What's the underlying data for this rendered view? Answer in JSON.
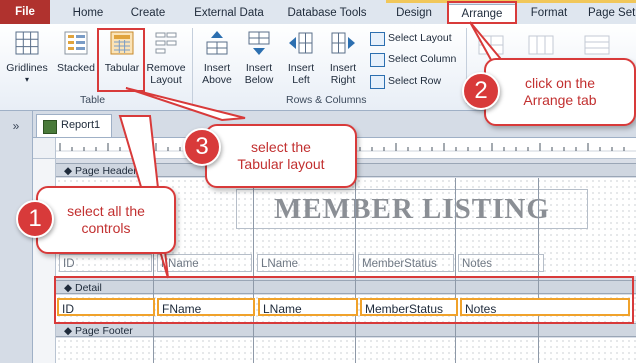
{
  "ribbon": {
    "tabs": {
      "file": "File",
      "home": "Home",
      "create": "Create",
      "external": "External Data",
      "dbtools": "Database Tools",
      "design": "Design",
      "arrange": "Arrange",
      "format": "Format",
      "pagesetup": "Page Set"
    },
    "table_group": {
      "label": "Table",
      "gridlines": "Gridlines",
      "stacked": "Stacked",
      "tabular": "Tabular",
      "remove_layout": "Remove\nLayout"
    },
    "rows_group": {
      "label": "Rows & Columns",
      "insert_above": "Insert\nAbove",
      "insert_below": "Insert\nBelow",
      "insert_left": "Insert\nLeft",
      "insert_right": "Insert\nRight",
      "select_layout": "Select Layout",
      "select_column": "Select Column",
      "select_row": "Select Row"
    }
  },
  "nav": {
    "toggle": "»"
  },
  "document": {
    "tab": "Report1"
  },
  "report": {
    "page_header_band": "Page Header",
    "detail_band": "Detail",
    "page_footer_band": "Page Footer",
    "title": "MEMBER LISTING",
    "header_labels": [
      "ID",
      "FName",
      "LName",
      "MemberStatus",
      "Notes"
    ],
    "detail_fields": [
      "ID",
      "FName",
      "LName",
      "MemberStatus",
      "Notes"
    ]
  },
  "callouts": {
    "step1": {
      "number": "1",
      "text": "select all the\ncontrols"
    },
    "step2": {
      "number": "2",
      "text": "click on the\nArrange tab"
    },
    "step3": {
      "number": "3",
      "text": "select the\nTabular layout"
    }
  },
  "colors": {
    "highlight": "#d83a3a",
    "selection": "#f0a22b",
    "file_tab": "#b0322e"
  }
}
